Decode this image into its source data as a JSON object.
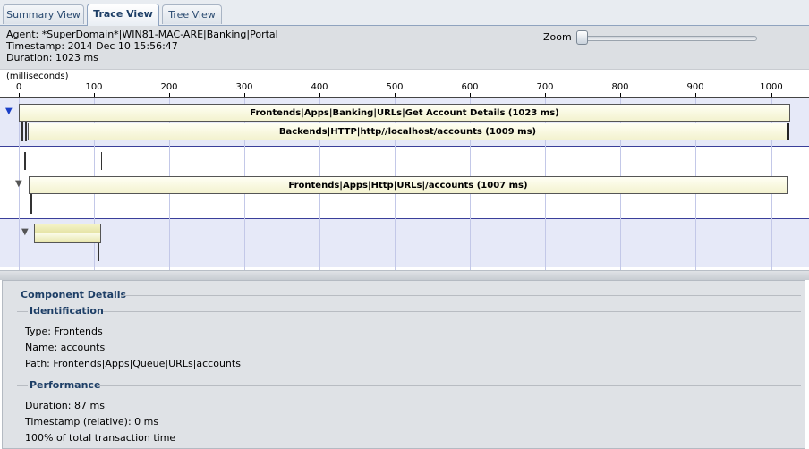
{
  "tabs": [
    {
      "label": "Summary View",
      "active": false
    },
    {
      "label": "Trace View",
      "active": true
    },
    {
      "label": "Tree View",
      "active": false
    }
  ],
  "info": {
    "agent": "Agent: *SuperDomain*|WIN81-MAC-ARE|Banking|Portal",
    "timestamp": "Timestamp: 2014 Dec 10 15:56:47",
    "duration": "Duration: 1023 ms"
  },
  "zoom": {
    "label": "Zoom",
    "level": 0
  },
  "timeline": {
    "units": "(milliseconds)",
    "ticks": [
      "0",
      "100",
      "200",
      "300",
      "400",
      "500",
      "600",
      "700",
      "800",
      "900",
      "1000"
    ]
  },
  "trace": {
    "row1_label": "Frontends|Apps|Banking|URLs|Get Account Details (1023 ms)",
    "row2_label": "Backends|HTTP|http//localhost/accounts (1009 ms)",
    "row3_label": "Frontends|Apps|Http|URLs|/accounts (1007 ms)"
  },
  "details": {
    "title": "Component Details",
    "identification": {
      "title": "Identification",
      "type": "Type: Frontends",
      "name": "Name: accounts",
      "path": "Path: Frontends|Apps|Queue|URLs|accounts"
    },
    "performance": {
      "title": "Performance",
      "duration": "Duration: 87 ms",
      "timestamp_relative": "Timestamp (relative): 0 ms",
      "percent": "100% of total transaction time"
    }
  },
  "colors": {
    "accent": "#1d3e66",
    "bar_fill": "#f3f2cf",
    "lane_bg": "#e6e9f8",
    "grid": "#c3c8e8"
  }
}
